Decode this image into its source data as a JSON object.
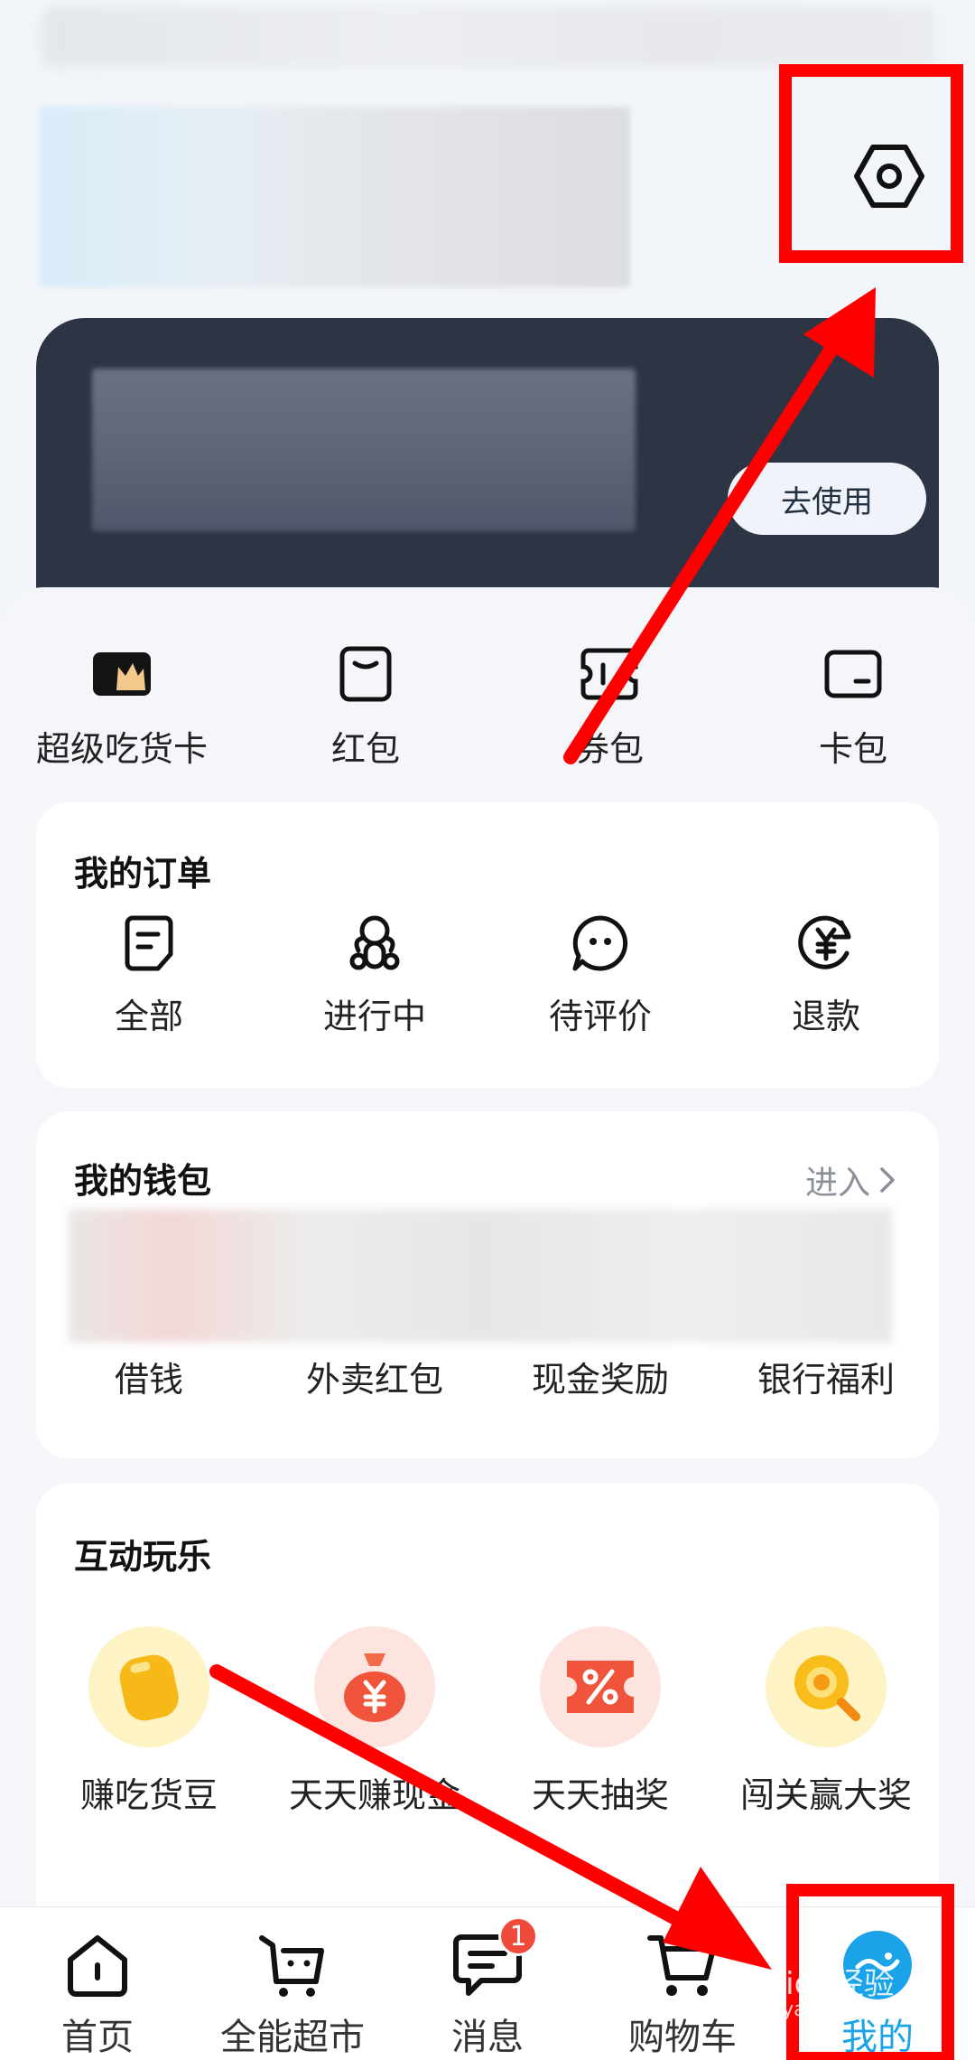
{
  "header": {
    "vip_card": {
      "use_button": "去使用"
    }
  },
  "quick_links": [
    {
      "label": "超级吃货卡",
      "icon": "super-foodie-card-icon"
    },
    {
      "label": "红包",
      "icon": "red-packet-icon"
    },
    {
      "label": "券包",
      "icon": "coupon-icon"
    },
    {
      "label": "卡包",
      "icon": "card-wallet-icon"
    }
  ],
  "orders": {
    "title": "我的订单",
    "items": [
      {
        "label": "全部",
        "icon": "order-list-icon"
      },
      {
        "label": "进行中",
        "icon": "delivery-rider-icon"
      },
      {
        "label": "待评价",
        "icon": "comment-icon"
      },
      {
        "label": "退款",
        "icon": "refund-icon"
      }
    ]
  },
  "wallet": {
    "title": "我的钱包",
    "enter": "进入",
    "items": [
      "借钱",
      "外卖红包",
      "现金奖励",
      "银行福利"
    ]
  },
  "fun": {
    "title": "互动玩乐",
    "items": [
      {
        "label": "赚吃货豆",
        "icon": "bean-icon"
      },
      {
        "label": "天天赚现金",
        "icon": "money-bag-icon"
      },
      {
        "label": "天天抽奖",
        "icon": "lottery-ticket-icon"
      },
      {
        "label": "闯关赢大奖",
        "icon": "magnifier-prize-icon"
      }
    ]
  },
  "tabbar": [
    {
      "label": "首页",
      "icon": "home-icon"
    },
    {
      "label": "全能超市",
      "icon": "supermarket-icon"
    },
    {
      "label": "消息",
      "icon": "message-icon",
      "badge": "1"
    },
    {
      "label": "购物车",
      "icon": "cart-icon"
    },
    {
      "label": "我的",
      "icon": "profile-icon",
      "active": true
    }
  ],
  "watermark": {
    "text": "Baidu经验",
    "sub": "jingyan.baidu.com"
  },
  "colors": {
    "accent": "#1aa3e8",
    "annotation": "#ff0000",
    "vip_card": "#2d3544"
  }
}
